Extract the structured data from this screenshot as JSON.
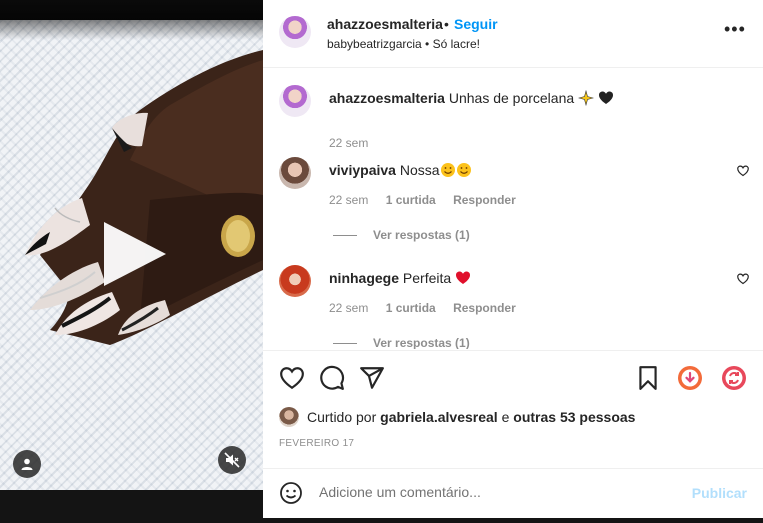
{
  "post": {
    "username": "ahazzoesmalteria",
    "separator": "•",
    "follow_label": "Seguir",
    "subtitle": "babybeatrizgarcia • Só lacre!",
    "more_icon": "more-options-icon"
  },
  "caption": {
    "username": "ahazzoesmalteria",
    "text": "Unhas de porcelana",
    "time": "22 sem"
  },
  "comments": [
    {
      "username": "viviypaiva",
      "text": "Nossa",
      "time": "22 sem",
      "likes": "1 curtida",
      "reply_label": "Responder",
      "view_replies": "Ver respostas (1)"
    },
    {
      "username": "ninhagege",
      "text": "Perfeita",
      "time": "22 sem",
      "likes": "1 curtida",
      "reply_label": "Responder",
      "view_replies": "Ver respostas (1)"
    }
  ],
  "actions": {
    "liked_prefix": "Curtido por",
    "liked_user": "gabriela.alvesreal",
    "liked_suffix_joiner": "e",
    "liked_others": "outras 53 pessoas",
    "date": "FEVEREIRO 17"
  },
  "add_comment": {
    "placeholder": "Adicione um comentário...",
    "publish_label": "Publicar"
  },
  "colors": {
    "accent": "#0095f6",
    "publish_disabled": "#b2dffc",
    "text": "#262626",
    "muted": "#8e8e8e"
  }
}
